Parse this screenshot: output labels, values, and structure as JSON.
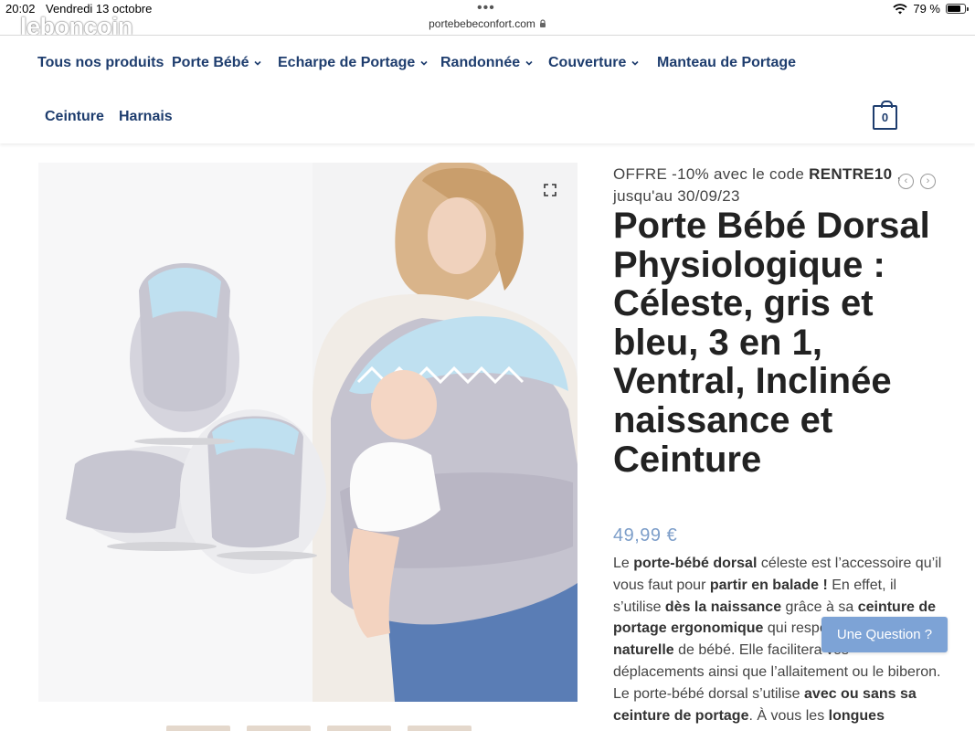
{
  "status_bar": {
    "time": "20:02",
    "date": "Vendredi 13 octobre",
    "battery": "79 %",
    "battery_level": 0.79
  },
  "browser": {
    "url": "portebebeconfort.com",
    "watermark": "leboncoin"
  },
  "nav": {
    "row1": [
      {
        "label": "Tous nos produits",
        "dropdown": false
      },
      {
        "label": "Porte Bébé",
        "dropdown": true
      },
      {
        "label": "Echarpe de Portage",
        "dropdown": true
      },
      {
        "label": "Randonnée",
        "dropdown": true
      },
      {
        "label": "Couverture",
        "dropdown": true
      },
      {
        "label": "Manteau de Portage",
        "dropdown": false
      }
    ],
    "row2": [
      {
        "label": "Ceinture"
      },
      {
        "label": "Harnais"
      }
    ],
    "cart_count": "0"
  },
  "product": {
    "offer_prefix": "OFFRE -10% avec le code ",
    "offer_code": "RENTRE10",
    "offer_suffix": " , jusqu'au 30/09/23",
    "title": "Porte Bébé Dorsal Physiologique : Céleste, gris et bleu, 3 en 1, Ventral, Inclinée naissance et Ceinture",
    "price": "49,99 €",
    "description": [
      {
        "t": "Le ",
        "b": false
      },
      {
        "t": "porte-bébé dorsal",
        "b": true
      },
      {
        "t": " céleste est l’accessoire qu’il vous faut pour ",
        "b": false
      },
      {
        "t": "partir en balade !",
        "b": true
      },
      {
        "t": " En effet, il s’utilise ",
        "b": false
      },
      {
        "t": "dès la naissance",
        "b": true
      },
      {
        "t": " grâce à sa ",
        "b": false
      },
      {
        "t": "ceinture de portage ergonomique",
        "b": true
      },
      {
        "t": " qui respecte la ",
        "b": false
      },
      {
        "t": "position naturelle",
        "b": true
      },
      {
        "t": " de bébé. Elle facilitera vos déplacements ainsi que l’allaitement ou le biberon. Le porte-bébé dorsal s’utilise ",
        "b": false
      },
      {
        "t": "avec ou sans sa ceinture de portage",
        "b": true
      },
      {
        "t": ". À vous les ",
        "b": false
      },
      {
        "t": "longues",
        "b": true
      }
    ],
    "question_button": "Une Question ?"
  },
  "colors": {
    "nav_text": "#1e3d6e",
    "price": "#7d9ec9",
    "question_button": "#7da3d6"
  }
}
